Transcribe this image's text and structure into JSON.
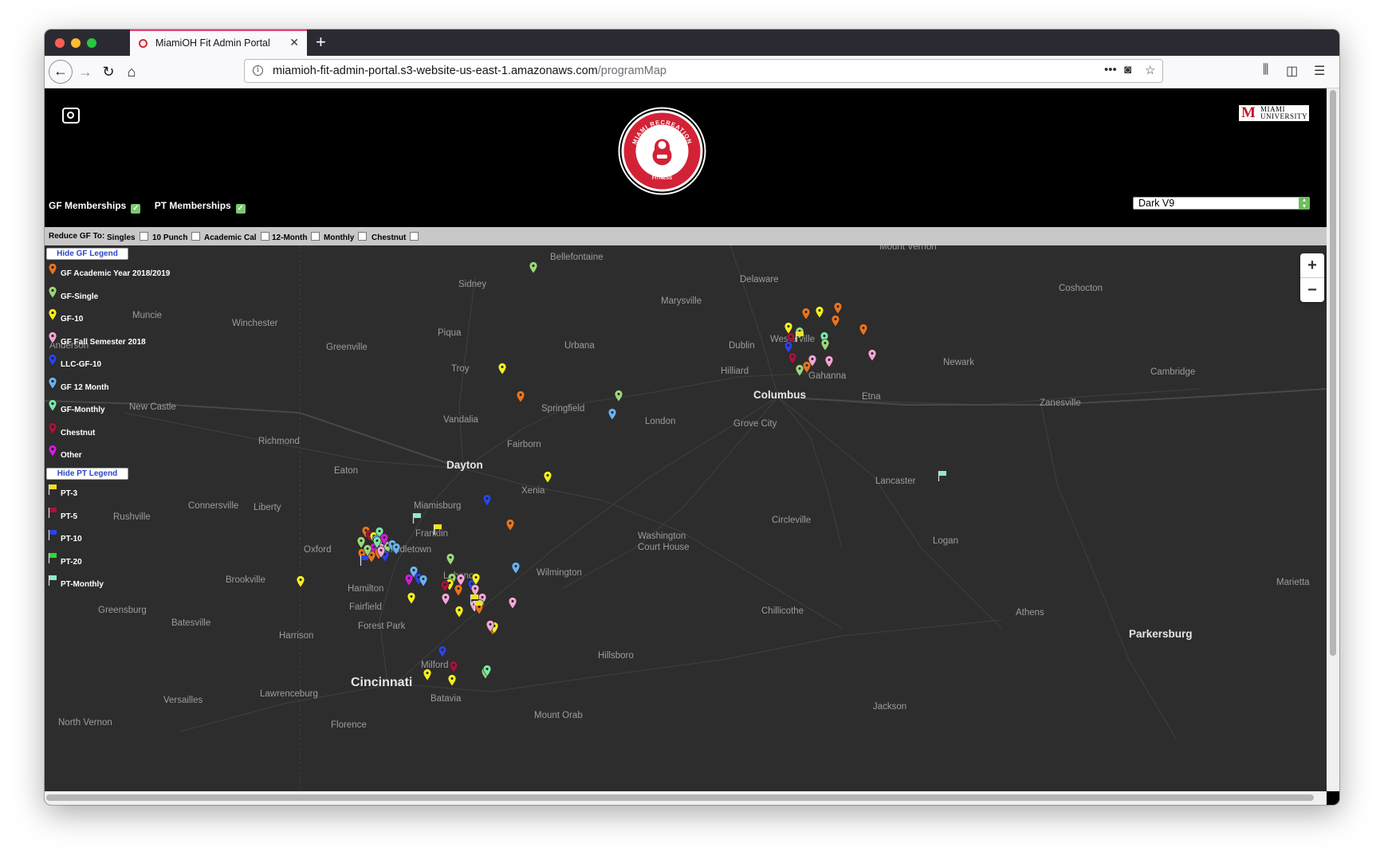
{
  "browser": {
    "tab_title": "MiamiOH Fit Admin Portal",
    "url_host": "miamioh-fit-admin-portal.s3-website-us-east-1.amazonaws.com",
    "url_path": "/programMap"
  },
  "header": {
    "logo_text_top": "MIAMI RECREATION",
    "logo_text_bottom": "FITNESS",
    "university_logo_line1": "MIAMI",
    "university_logo_line2": "UNIVERSITY",
    "university_logo_letter": "M"
  },
  "memberships": {
    "gf_label": "GF Memberships",
    "pt_label": "PT Memberships",
    "gf_checked": true,
    "pt_checked": true
  },
  "map_style_select": {
    "selected": "Dark V9"
  },
  "reduce_filter": {
    "label": "Reduce GF To:",
    "options": [
      "Singles",
      "10 Punch",
      "Academic Cal",
      "12-Month",
      "Monthly",
      "Chestnut"
    ]
  },
  "legend": {
    "hide_gf_label": "Hide GF Legend",
    "hide_pt_label": "Hide PT Legend",
    "gf_items": [
      {
        "label": "GF Academic Year 2018/2019",
        "color": "#e8731d"
      },
      {
        "label": "GF-Single",
        "color": "#9bd77a"
      },
      {
        "label": "GF-10",
        "color": "#f4ef1e"
      },
      {
        "label": "GF Fall Semester 2018",
        "color": "#f3a6d4"
      },
      {
        "label": "LLC-GF-10",
        "color": "#2a44e6"
      },
      {
        "label": "GF 12 Month",
        "color": "#6ab2ee"
      },
      {
        "label": "GF-Monthly",
        "color": "#76e6a8"
      },
      {
        "label": "Chestnut",
        "color": "#a3153a"
      },
      {
        "label": "Other",
        "color": "#d41ad8"
      }
    ],
    "pt_items": [
      {
        "label": "PT-3",
        "color": "#f4e11e"
      },
      {
        "label": "PT-5",
        "color": "#a3153a"
      },
      {
        "label": "PT-10",
        "color": "#2a44e6"
      },
      {
        "label": "PT-20",
        "color": "#2fd63a"
      },
      {
        "label": "PT-Monthly",
        "color": "#8fe8cf"
      }
    ]
  },
  "map": {
    "zoom_in": "+",
    "zoom_out": "−",
    "labels": [
      {
        "text": "Mount Vernon",
        "cls": ""
      },
      {
        "text": "Bellefontaine",
        "cls": ""
      },
      {
        "text": "Delaware",
        "cls": ""
      },
      {
        "text": "Coshocton",
        "cls": ""
      },
      {
        "text": "Sidney",
        "cls": ""
      },
      {
        "text": "Marysville",
        "cls": ""
      },
      {
        "text": "Muncie",
        "cls": ""
      },
      {
        "text": "Winchester",
        "cls": ""
      },
      {
        "text": "Piqua",
        "cls": ""
      },
      {
        "text": "Westerville",
        "cls": ""
      },
      {
        "text": "Greenville",
        "cls": ""
      },
      {
        "text": "Urbana",
        "cls": ""
      },
      {
        "text": "Dublin",
        "cls": ""
      },
      {
        "text": "Newark",
        "cls": ""
      },
      {
        "text": "Anderson",
        "cls": ""
      },
      {
        "text": "Troy",
        "cls": ""
      },
      {
        "text": "Hilliard",
        "cls": ""
      },
      {
        "text": "Gahanna",
        "cls": ""
      },
      {
        "text": "Cambridge",
        "cls": ""
      },
      {
        "text": "Columbus",
        "cls": "big"
      },
      {
        "text": "Etna",
        "cls": ""
      },
      {
        "text": "Zanesville",
        "cls": ""
      },
      {
        "text": "New Castle",
        "cls": ""
      },
      {
        "text": "Springfield",
        "cls": ""
      },
      {
        "text": "Vandalia",
        "cls": ""
      },
      {
        "text": "London",
        "cls": ""
      },
      {
        "text": "Grove City",
        "cls": ""
      },
      {
        "text": "Richmond",
        "cls": ""
      },
      {
        "text": "Fairborn",
        "cls": ""
      },
      {
        "text": "Dayton",
        "cls": "big"
      },
      {
        "text": "Eaton",
        "cls": ""
      },
      {
        "text": "Xenia",
        "cls": ""
      },
      {
        "text": "Lancaster",
        "cls": ""
      },
      {
        "text": "Connersville",
        "cls": ""
      },
      {
        "text": "Liberty",
        "cls": ""
      },
      {
        "text": "Miamisburg",
        "cls": ""
      },
      {
        "text": "Rushville",
        "cls": ""
      },
      {
        "text": "Franklin",
        "cls": ""
      },
      {
        "text": "Circleville",
        "cls": ""
      },
      {
        "text": "Washington",
        "cls": ""
      },
      {
        "text": "Court House",
        "cls": ""
      },
      {
        "text": "Logan",
        "cls": ""
      },
      {
        "text": "Oxford",
        "cls": ""
      },
      {
        "text": "Middletown",
        "cls": ""
      },
      {
        "text": "Wilmington",
        "cls": ""
      },
      {
        "text": "Brookville",
        "cls": ""
      },
      {
        "text": "Lebanon",
        "cls": ""
      },
      {
        "text": "Marietta",
        "cls": ""
      },
      {
        "text": "Hamilton",
        "cls": ""
      },
      {
        "text": "Greensburg",
        "cls": ""
      },
      {
        "text": "Fairfield",
        "cls": ""
      },
      {
        "text": "Chillicothe",
        "cls": ""
      },
      {
        "text": "Athens",
        "cls": ""
      },
      {
        "text": "Batesville",
        "cls": ""
      },
      {
        "text": "Forest Park",
        "cls": ""
      },
      {
        "text": "Parkersburg",
        "cls": "big"
      },
      {
        "text": "Harrison",
        "cls": ""
      },
      {
        "text": "Hillsboro",
        "cls": ""
      },
      {
        "text": "Milford",
        "cls": ""
      },
      {
        "text": "Cincinnati",
        "cls": "huge"
      },
      {
        "text": "Lawrenceburg",
        "cls": ""
      },
      {
        "text": "Batavia",
        "cls": ""
      },
      {
        "text": "Versailles",
        "cls": ""
      },
      {
        "text": "Jackson",
        "cls": ""
      },
      {
        "text": "Mount Orab",
        "cls": ""
      },
      {
        "text": "North Vernon",
        "cls": ""
      },
      {
        "text": "Florence",
        "cls": ""
      }
    ]
  }
}
